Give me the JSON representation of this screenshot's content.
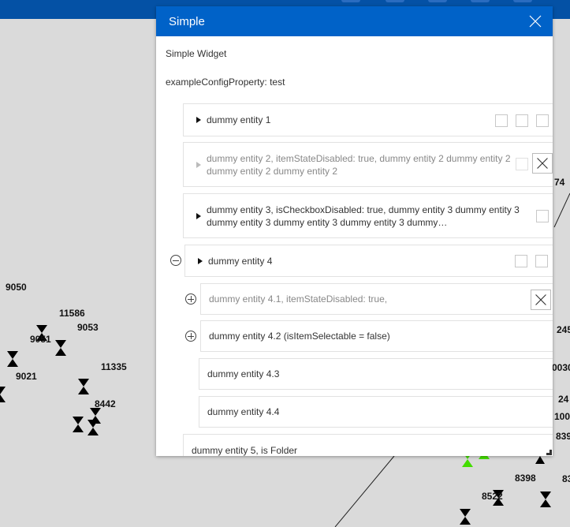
{
  "panel": {
    "title": "Simple",
    "subtitle": "Simple Widget",
    "config": "exampleConfigProperty: test"
  },
  "items": [
    {
      "label": "dummy entity 1"
    },
    {
      "label": "dummy entity 2, itemStateDisabled: true, dummy entity 2 dummy entity 2 dummy entity 2 dummy entity 2"
    },
    {
      "label": "dummy entity 3, isCheckboxDisabled: true, dummy entity 3 dummy entity 3 dummy entity 3 dummy entity 3 dummy entity 3 dummy…"
    },
    {
      "label": "dummy entity 4",
      "children": [
        {
          "label": "dummy entity 4.1, itemStateDisabled: true,"
        },
        {
          "label": "dummy entity 4.2 (isItemSelectable = false)"
        },
        {
          "label": "dummy entity 4.3"
        },
        {
          "label": "dummy entity 4.4"
        }
      ]
    },
    {
      "label": "dummy entity 5, is Folder"
    }
  ],
  "map": {
    "labels": [
      "9050",
      "11586",
      "9053",
      "9051",
      "9021",
      "11335",
      "8442",
      "74",
      "245",
      "0030",
      "24",
      "100",
      "839",
      "8398",
      "83",
      "8522"
    ],
    "accent": "#0062c8",
    "highlight": "#44dd00"
  }
}
